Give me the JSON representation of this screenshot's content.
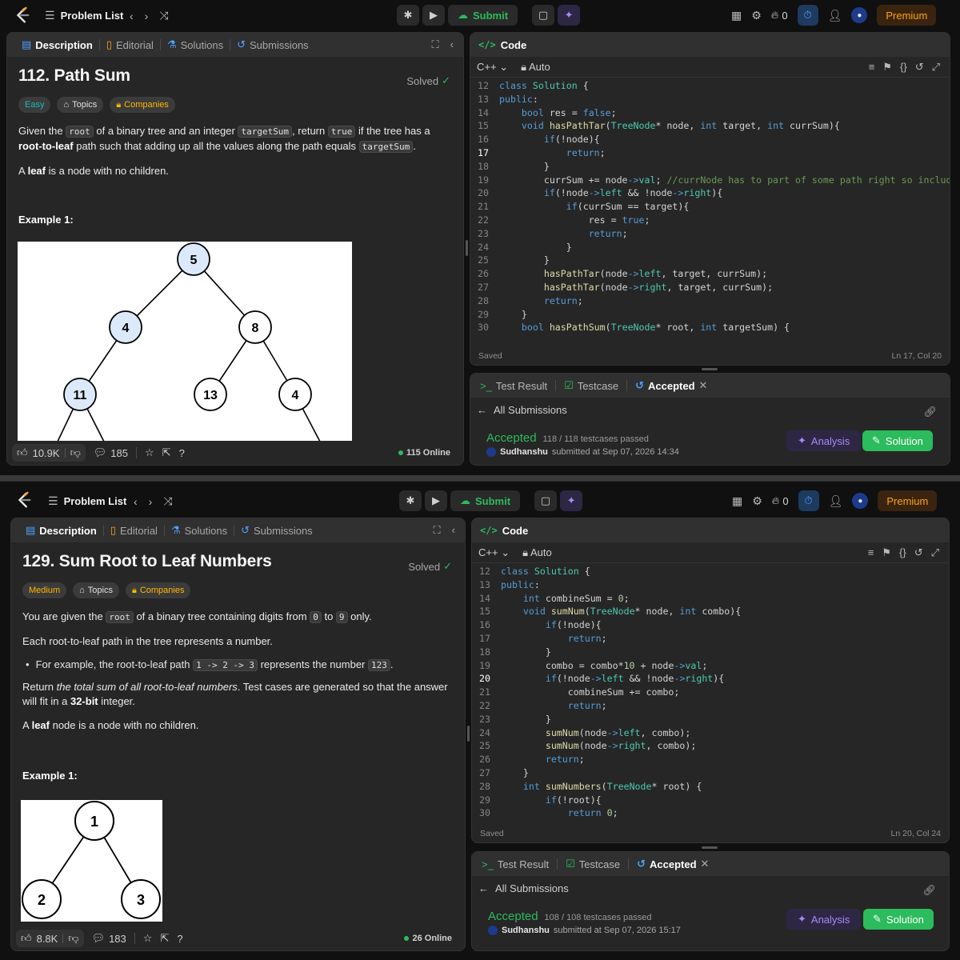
{
  "colors": {
    "accent_green": "#2cbb5d",
    "premium_orange": "#ffa116",
    "easy": "#1cbaba",
    "medium": "#ffb800",
    "ai_purple": "#a78bfa"
  },
  "shots": [
    {
      "nav": {
        "problem_list": "Problem List",
        "submit": "Submit",
        "streak": "0",
        "premium": "Premium"
      },
      "desc_tabs": [
        "Description",
        "Editorial",
        "Solutions",
        "Submissions"
      ],
      "problem": {
        "title": "112. Path Sum",
        "solved": "Solved",
        "difficulty": "Easy",
        "topics": "Topics",
        "companies": "Companies",
        "p1": [
          "Given the ",
          "root",
          " of a binary tree and an integer ",
          "targetSum",
          ", return ",
          "true",
          " if the tree has a ",
          "root-to-leaf",
          " path such that adding up all the values along the path equals ",
          "targetSum",
          "."
        ],
        "p2": [
          "A ",
          "leaf",
          " is a node with no children."
        ],
        "example": "Example 1:",
        "tree_nodes": [
          "5",
          "4",
          "8",
          "11",
          "13",
          "4"
        ]
      },
      "bottom": {
        "likes": "10.9K",
        "comments": "185",
        "online": "115 Online"
      },
      "code": {
        "header": "Code",
        "lang": "C++",
        "mode": "Auto",
        "lines": [
          {
            "n": "12",
            "t": "class Solution {"
          },
          {
            "n": "13",
            "t": "public:"
          },
          {
            "n": "14",
            "t": "    bool res = false;"
          },
          {
            "n": "15",
            "t": "    void hasPathTar(TreeNode* node, int target, int currSum){"
          },
          {
            "n": "16",
            "t": "        if(!node){"
          },
          {
            "n": "17",
            "t": "            return;"
          },
          {
            "n": "18",
            "t": "        }"
          },
          {
            "n": "19",
            "t": "        currSum += node->val; //currNode has to part of some path right so include"
          },
          {
            "n": "20",
            "t": "        if(!node->left && !node->right){"
          },
          {
            "n": "21",
            "t": "            if(currSum == target){"
          },
          {
            "n": "22",
            "t": "                res = true;"
          },
          {
            "n": "23",
            "t": "                return;"
          },
          {
            "n": "24",
            "t": "            }"
          },
          {
            "n": "25",
            "t": "        }"
          },
          {
            "n": "26",
            "t": "        hasPathTar(node->left, target, currSum);"
          },
          {
            "n": "27",
            "t": "        hasPathTar(node->right, target, currSum);"
          },
          {
            "n": "28",
            "t": "        return;"
          },
          {
            "n": "29",
            "t": "    }"
          },
          {
            "n": "30",
            "t": "    bool hasPathSum(TreeNode* root, int targetSum) {"
          }
        ],
        "current_line": "17",
        "saved": "Saved",
        "position": "Ln 17, Col 20"
      },
      "result": {
        "tabs": [
          "Test Result",
          "Testcase",
          "Accepted"
        ],
        "all_submissions": "All Submissions",
        "status": "Accepted",
        "cases": "118 / 118 testcases passed",
        "user": "Sudhanshu",
        "submitted": "submitted at Sep 07, 2026 14:34",
        "analysis": "Analysis",
        "solution": "Solution"
      }
    },
    {
      "nav": {
        "problem_list": "Problem List",
        "submit": "Submit",
        "streak": "0",
        "premium": "Premium"
      },
      "desc_tabs": [
        "Description",
        "Editorial",
        "Solutions",
        "Submissions"
      ],
      "problem": {
        "title": "129. Sum Root to Leaf Numbers",
        "solved": "Solved",
        "difficulty": "Medium",
        "topics": "Topics",
        "companies": "Companies",
        "p1": [
          "You are given the ",
          "root",
          " of a binary tree containing digits from ",
          "0",
          " to ",
          "9",
          " only."
        ],
        "p2": "Each root-to-leaf path in the tree represents a number.",
        "bullet": [
          "For example, the root-to-leaf path ",
          "1 -> 2 -> 3",
          " represents the number ",
          "123",
          "."
        ],
        "p3": [
          "Return ",
          "the total sum of all root-to-leaf numbers",
          ". Test cases are generated so that the answer will fit in a ",
          "32-bit",
          " integer."
        ],
        "p4": [
          "A ",
          "leaf",
          " node is a node with no children."
        ],
        "example": "Example 1:",
        "tree_nodes": [
          "1",
          "2",
          "3"
        ]
      },
      "bottom": {
        "likes": "8.8K",
        "comments": "183",
        "online": "26 Online"
      },
      "code": {
        "header": "Code",
        "lang": "C++",
        "mode": "Auto",
        "lines": [
          {
            "n": "12",
            "t": "class Solution {"
          },
          {
            "n": "13",
            "t": "public:"
          },
          {
            "n": "14",
            "t": "    int combineSum = 0;"
          },
          {
            "n": "15",
            "t": "    void sumNum(TreeNode* node, int combo){"
          },
          {
            "n": "16",
            "t": "        if(!node){"
          },
          {
            "n": "17",
            "t": "            return;"
          },
          {
            "n": "18",
            "t": "        }"
          },
          {
            "n": "19",
            "t": "        combo = combo*10 + node->val;"
          },
          {
            "n": "20",
            "t": "        if(!node->left && !node->right){"
          },
          {
            "n": "21",
            "t": "            combineSum += combo;"
          },
          {
            "n": "22",
            "t": "            return;"
          },
          {
            "n": "23",
            "t": "        }"
          },
          {
            "n": "24",
            "t": "        sumNum(node->left, combo);"
          },
          {
            "n": "25",
            "t": "        sumNum(node->right, combo);"
          },
          {
            "n": "26",
            "t": "        return;"
          },
          {
            "n": "27",
            "t": "    }"
          },
          {
            "n": "28",
            "t": "    int sumNumbers(TreeNode* root) {"
          },
          {
            "n": "29",
            "t": "        if(!root){"
          },
          {
            "n": "30",
            "t": "            return 0;"
          }
        ],
        "current_line": "20",
        "saved": "Saved",
        "position": "Ln 20, Col 24"
      },
      "result": {
        "tabs": [
          "Test Result",
          "Testcase",
          "Accepted"
        ],
        "all_submissions": "All Submissions",
        "status": "Accepted",
        "cases": "108 / 108 testcases passed",
        "user": "Sudhanshu",
        "submitted": "submitted at Sep 07, 2026 15:17",
        "analysis": "Analysis",
        "solution": "Solution"
      }
    }
  ]
}
